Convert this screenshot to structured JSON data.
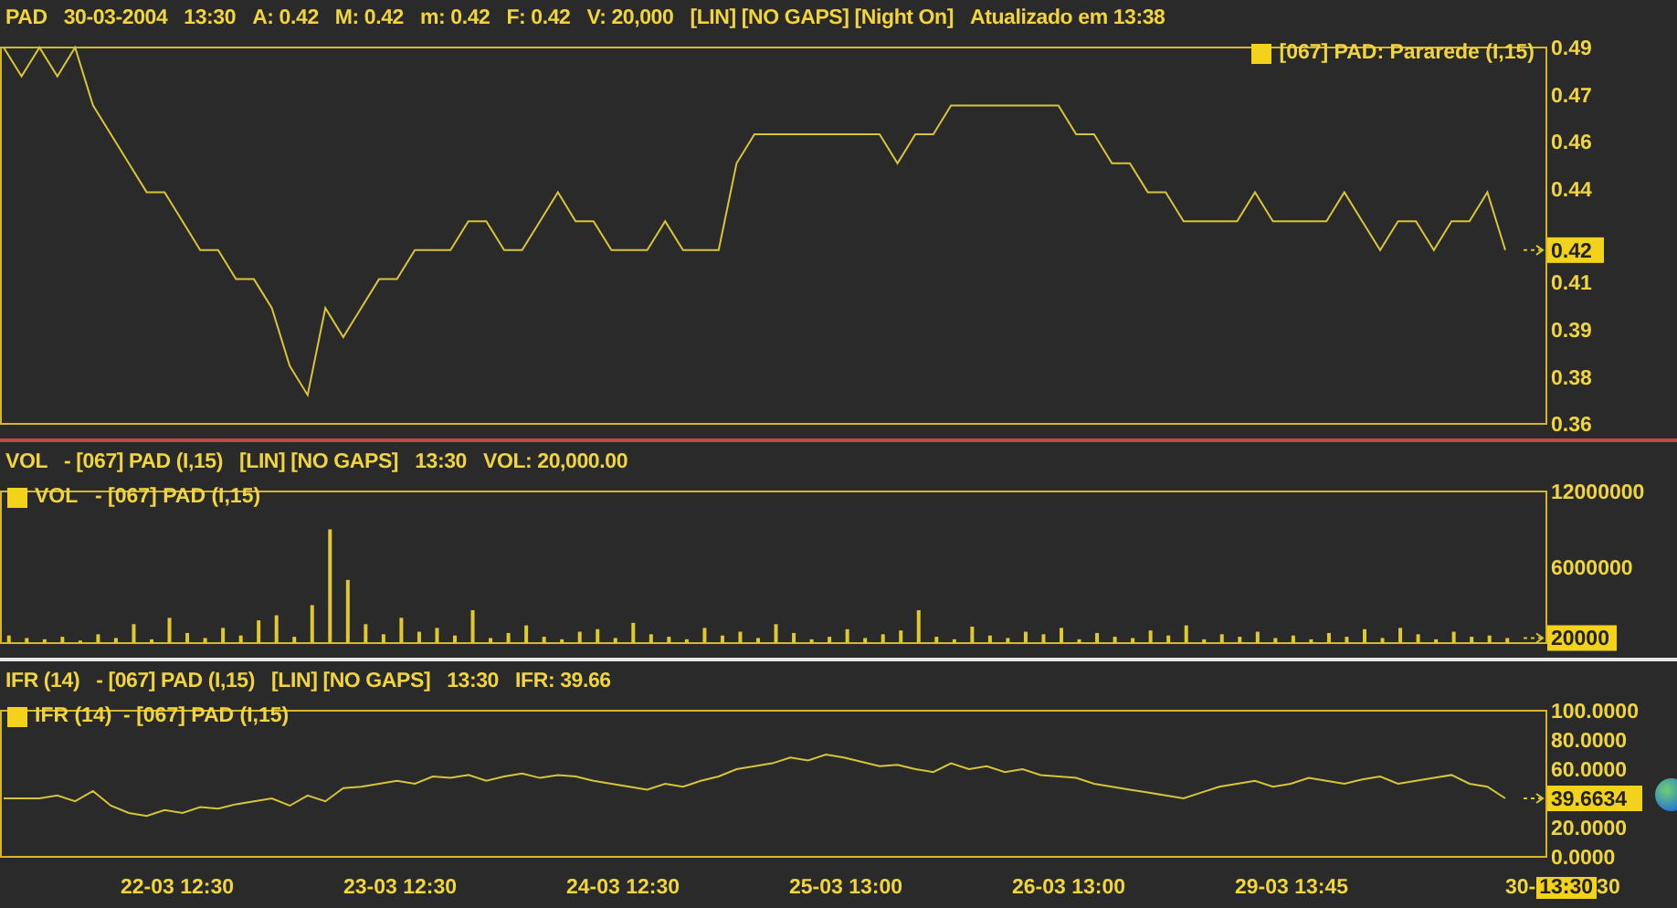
{
  "header": [
    "PAD",
    "30-03-2004",
    "13:30",
    "A: 0.42",
    "M: 0.42",
    "m: 0.42",
    "F: 0.42",
    "V: 20,000",
    "[LIN] [NO GAPS] [Night On]",
    "Atualizado em 13:38"
  ],
  "panels": [
    {
      "kind": "price",
      "legend": "[067] PAD: Pararede (I,15)",
      "current_value": "0.42",
      "chart_data": {
        "type": "line",
        "ylim": [
          0.36,
          0.49
        ],
        "yticks": [
          {
            "value": 0.49,
            "label": "0.49"
          },
          {
            "value": 0.4737,
            "label": "0.47"
          },
          {
            "value": 0.4575,
            "label": "0.46"
          },
          {
            "value": 0.4412,
            "label": "0.44"
          },
          {
            "value": 0.409,
            "label": "0.41"
          },
          {
            "value": 0.3925,
            "label": "0.39"
          },
          {
            "value": 0.376,
            "label": "0.38"
          },
          {
            "value": 0.36,
            "label": "0.36"
          }
        ],
        "series": [
          {
            "color": "#d8c43a",
            "values": [
              0.49,
              0.48,
              0.49,
              0.48,
              0.49,
              0.47,
              0.46,
              0.45,
              0.44,
              0.44,
              0.43,
              0.42,
              0.42,
              0.41,
              0.41,
              0.4,
              0.38,
              0.37,
              0.4,
              0.39,
              0.4,
              0.41,
              0.41,
              0.42,
              0.42,
              0.42,
              0.43,
              0.43,
              0.42,
              0.42,
              0.43,
              0.44,
              0.43,
              0.43,
              0.42,
              0.42,
              0.42,
              0.43,
              0.42,
              0.42,
              0.42,
              0.45,
              0.46,
              0.46,
              0.46,
              0.46,
              0.46,
              0.46,
              0.46,
              0.46,
              0.45,
              0.46,
              0.46,
              0.47,
              0.47,
              0.47,
              0.47,
              0.47,
              0.47,
              0.47,
              0.46,
              0.46,
              0.45,
              0.45,
              0.44,
              0.44,
              0.43,
              0.43,
              0.43,
              0.43,
              0.44,
              0.43,
              0.43,
              0.43,
              0.43,
              0.44,
              0.43,
              0.42,
              0.43,
              0.43,
              0.42,
              0.43,
              0.43,
              0.44,
              0.42
            ]
          }
        ]
      }
    },
    {
      "kind": "volume",
      "header": [
        "VOL",
        "- [067] PAD (I,15)",
        "[LIN] [NO GAPS]",
        "13:30",
        "VOL: 20,000.00"
      ],
      "legend": "VOL   - [067] PAD (I,15)",
      "current_value": "20000",
      "chart_data": {
        "type": "bar",
        "ylim": [
          0,
          12000000
        ],
        "yticks": [
          {
            "value": 12000000,
            "label": "12000000"
          },
          {
            "value": 6000000,
            "label": "6000000"
          }
        ],
        "series": [
          {
            "color": "#e0c830",
            "values": [
              600000,
              400000,
              300000,
              500000,
              200000,
              700000,
              400000,
              1500000,
              300000,
              2000000,
              800000,
              400000,
              1200000,
              600000,
              1800000,
              2200000,
              500000,
              3000000,
              9000000,
              5000000,
              1500000,
              700000,
              2000000,
              900000,
              1200000,
              600000,
              2600000,
              400000,
              800000,
              1400000,
              500000,
              300000,
              900000,
              1100000,
              400000,
              1600000,
              700000,
              500000,
              300000,
              1200000,
              600000,
              900000,
              400000,
              1500000,
              800000,
              300000,
              500000,
              1100000,
              400000,
              700000,
              1000000,
              2600000,
              500000,
              300000,
              1300000,
              600000,
              400000,
              900000,
              700000,
              1200000,
              300000,
              800000,
              500000,
              400000,
              1000000,
              600000,
              1400000,
              300000,
              700000,
              500000,
              900000,
              400000,
              600000,
              300000,
              800000,
              500000,
              1100000,
              400000,
              1200000,
              700000,
              300000,
              900000,
              500000,
              600000,
              400000
            ]
          }
        ]
      }
    },
    {
      "kind": "oscillator",
      "header": [
        "IFR (14)",
        "- [067] PAD (I,15)",
        "[LIN] [NO GAPS]",
        "13:30",
        "IFR: 39.66"
      ],
      "legend": "IFR (14)  - [067] PAD (I,15)",
      "current_value": "39.6634",
      "chart_data": {
        "type": "line",
        "ylim": [
          0,
          100
        ],
        "yticks": [
          {
            "value": 100,
            "label": "100.0000"
          },
          {
            "value": 80,
            "label": "80.0000"
          },
          {
            "value": 60,
            "label": "60.0000"
          },
          {
            "value": 20,
            "label": "20.0000"
          },
          {
            "value": 0,
            "label": "0.0000"
          }
        ],
        "series": [
          {
            "color": "#d8c43a",
            "values": [
              40,
              40,
              40,
              42,
              38,
              45,
              35,
              30,
              28,
              32,
              30,
              34,
              33,
              36,
              38,
              40,
              35,
              42,
              38,
              47,
              48,
              50,
              52,
              50,
              55,
              54,
              56,
              52,
              55,
              57,
              54,
              56,
              55,
              52,
              50,
              48,
              46,
              50,
              48,
              52,
              55,
              60,
              62,
              64,
              68,
              66,
              70,
              68,
              65,
              62,
              63,
              60,
              58,
              64,
              60,
              62,
              58,
              60,
              56,
              55,
              54,
              50,
              48,
              46,
              44,
              42,
              40,
              44,
              48,
              50,
              52,
              48,
              50,
              54,
              52,
              50,
              53,
              55,
              50,
              52,
              54,
              56,
              50,
              48,
              40
            ]
          }
        ]
      }
    }
  ],
  "time_axis": {
    "labels": [
      "22-03 12:30",
      "23-03 12:30",
      "24-03 12:30",
      "25-03 13:00",
      "26-03 13:00",
      "29-03 13:45"
    ],
    "cut_label_start": "30-",
    "cursor_time": "13:30",
    "cut_label_end": "30"
  }
}
